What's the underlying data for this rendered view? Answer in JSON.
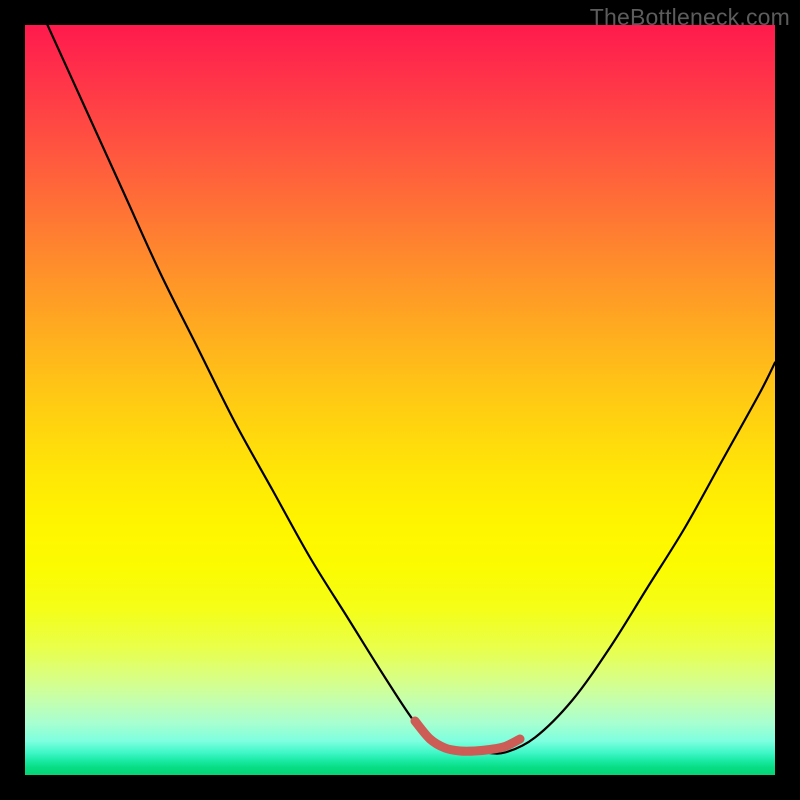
{
  "watermark": "TheBottleneck.com",
  "colors": {
    "background": "#000000",
    "curve": "#000000",
    "marker": "#cc5c55",
    "watermark": "#5c5c5c"
  },
  "chart_data": {
    "type": "line",
    "title": "",
    "xlabel": "",
    "ylabel": "",
    "xlim": [
      0,
      100
    ],
    "ylim": [
      0,
      100
    ],
    "grid": false,
    "legend": false,
    "gradient_background": {
      "top": "#ff1a4d",
      "mid": "#ffe706",
      "bottom": "#04d574"
    },
    "series": [
      {
        "name": "bottleneck-curve",
        "x": [
          3,
          8,
          13,
          18,
          23,
          28,
          33,
          38,
          43,
          48,
          52,
          55,
          58,
          61,
          64,
          68,
          73,
          78,
          83,
          88,
          93,
          98,
          100
        ],
        "y": [
          100,
          89,
          78,
          67,
          57,
          47,
          38,
          29,
          21,
          13,
          7,
          4,
          3,
          3,
          3,
          5,
          10,
          17,
          25,
          33,
          42,
          51,
          55
        ]
      },
      {
        "name": "optimal-range-marker",
        "x": [
          52,
          54,
          56,
          58,
          60,
          62,
          64,
          66
        ],
        "y": [
          7.2,
          4.8,
          3.6,
          3.2,
          3.2,
          3.4,
          3.8,
          4.8
        ]
      }
    ]
  }
}
